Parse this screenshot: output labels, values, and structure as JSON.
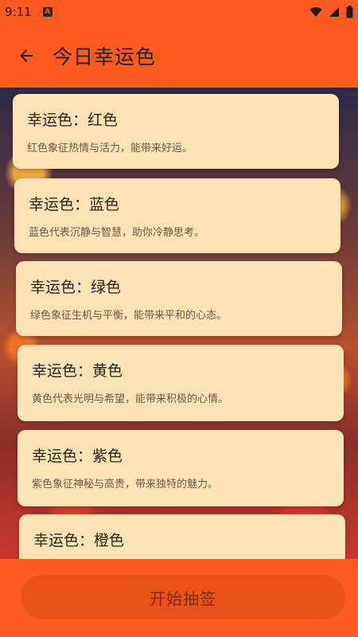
{
  "status": {
    "time": "9:11",
    "notification_letter": "A"
  },
  "header": {
    "title": "今日幸运色"
  },
  "cards": [
    {
      "title": "幸运色：红色",
      "description": "红色象征热情与活力，能带来好运。"
    },
    {
      "title": "幸运色：蓝色",
      "description": "蓝色代表沉静与智慧，助你冷静思考。"
    },
    {
      "title": "幸运色：绿色",
      "description": "绿色象征生机与平衡，能带来平和的心态。"
    },
    {
      "title": "幸运色：黄色",
      "description": "黄色代表光明与希望，能带来积极的心情。"
    },
    {
      "title": "幸运色：紫色",
      "description": "紫色象征神秘与高贵，带来独特的魅力。"
    },
    {
      "title": "幸运色：橙色",
      "description": ""
    }
  ],
  "footer": {
    "button_label": "开始抽签"
  },
  "colors": {
    "accent": "#ff5a1f",
    "card": "#fde2b3"
  }
}
